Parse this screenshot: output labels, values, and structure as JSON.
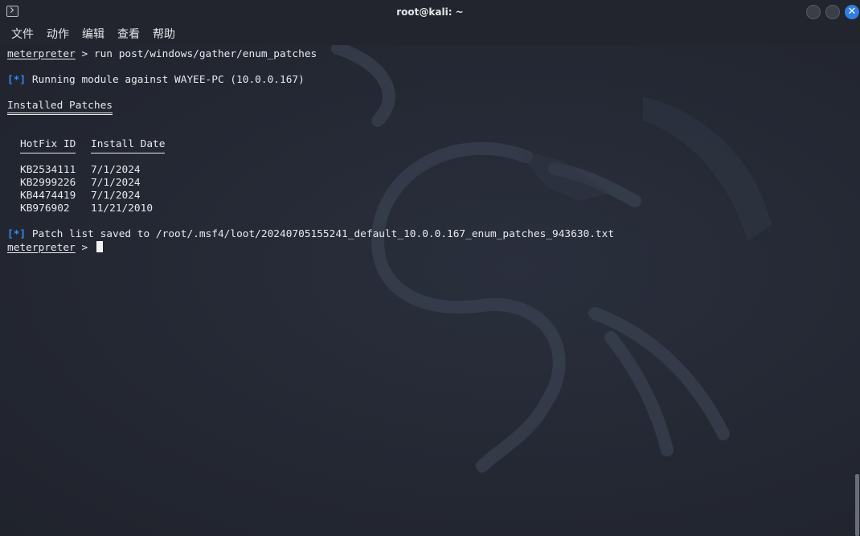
{
  "window": {
    "title": "root@kali: ~",
    "close_glyph": "✕"
  },
  "menu": {
    "items": [
      "文件",
      "动作",
      "编辑",
      "查看",
      "帮助"
    ]
  },
  "terminal": {
    "prompt": "meterpreter",
    "separator": " > ",
    "command": "run post/windows/gather/enum_patches",
    "status_marker": "[*]",
    "running_text": " Running module against WAYEE-PC (10.0.0.167)",
    "table_title": "Installed Patches",
    "columns": [
      "HotFix ID",
      "Install Date"
    ],
    "rows": [
      {
        "id": "KB2534111",
        "date": "7/1/2024"
      },
      {
        "id": "KB2999226",
        "date": "7/1/2024"
      },
      {
        "id": "KB4474419",
        "date": "7/1/2024"
      },
      {
        "id": "KB976902",
        "date": "11/21/2010"
      }
    ],
    "saved_text": " Patch list saved to /root/.msf4/loot/20240705155241_default_10.0.0.167_enum_patches_943630.txt"
  },
  "colors": {
    "background": "#232631",
    "status_marker": "#2f8df5",
    "close_button": "#2f7ee0"
  }
}
